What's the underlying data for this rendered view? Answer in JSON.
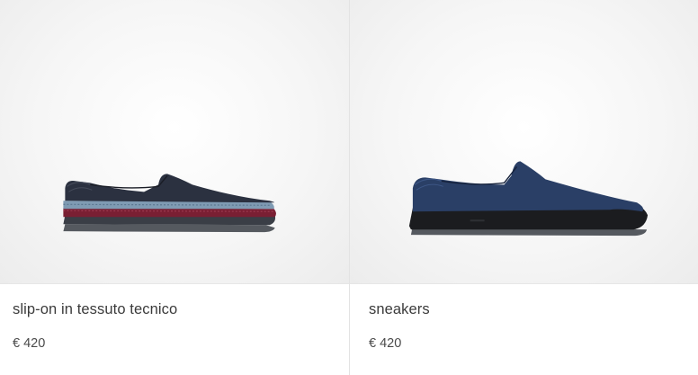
{
  "products": [
    {
      "name": "slip-on in tessuto tecnico",
      "price": "€ 420",
      "image_icon": "slip-on-shoe-image",
      "colors": {
        "upper": "#2b3140",
        "stripe_red": "#7a1f33",
        "stripe_blue": "#7f9bb3",
        "sole": "#4a4f57"
      }
    },
    {
      "name": "sneakers",
      "price": "€ 420",
      "image_icon": "sneaker-shoe-image",
      "colors": {
        "upper": "#2a3f66",
        "sole": "#1b1c1f",
        "outsole": "#55595f"
      }
    }
  ]
}
